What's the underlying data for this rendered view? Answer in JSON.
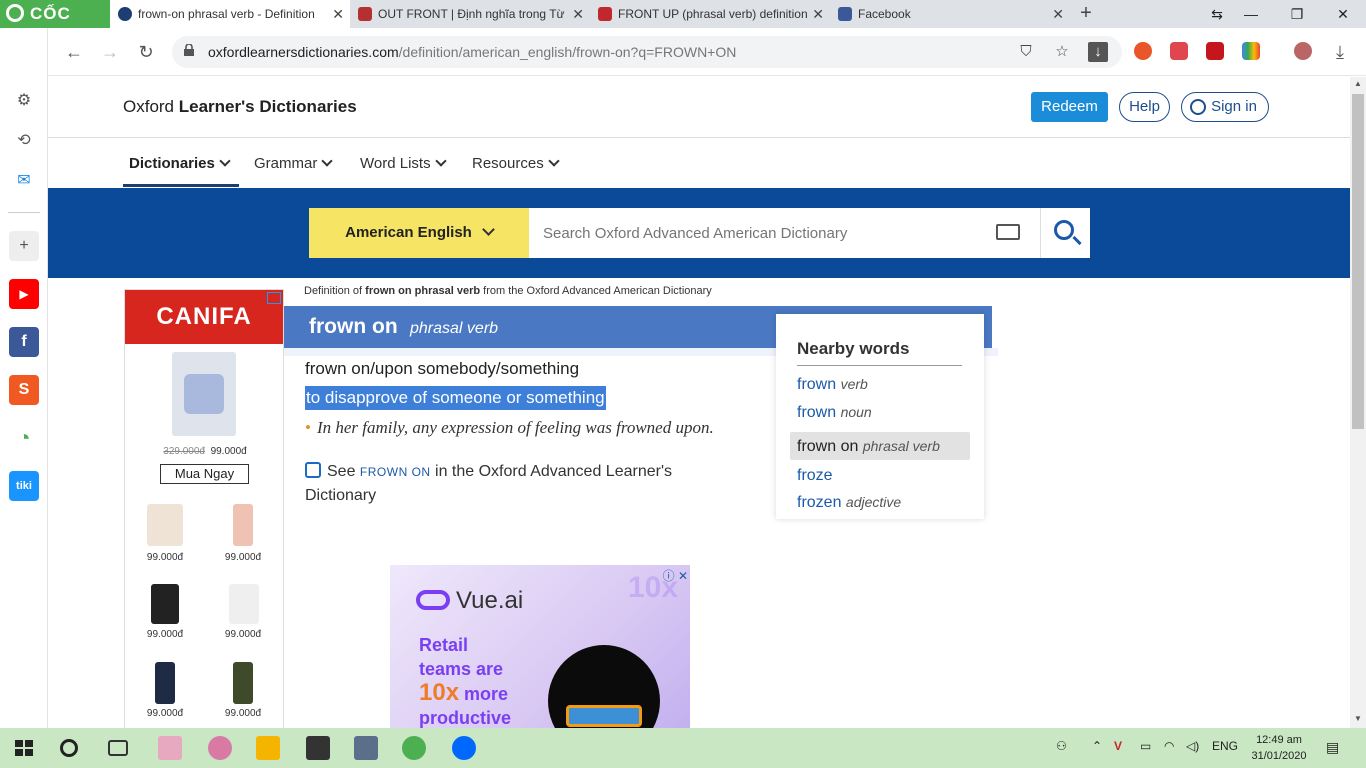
{
  "browser": {
    "logo": "CỐC CỐC",
    "tabs": [
      {
        "title": "frown-on phrasal verb - Definition",
        "active": true
      },
      {
        "title": "OUT FRONT | Định nghĩa trong Từ",
        "active": false
      },
      {
        "title": "FRONT UP (phrasal verb) definition",
        "active": false
      },
      {
        "title": "Facebook",
        "active": false
      }
    ],
    "url_host": "oxfordlearnersdictionaries.com",
    "url_path": "/definition/american_english/frown-on?q=FROWN+ON"
  },
  "site": {
    "brand_light": "Oxford ",
    "brand_bold": "Learner's Dictionaries",
    "redeem_label": "Redeem",
    "help_label": "Help",
    "signin_label": "Sign in",
    "nav": [
      "Dictionaries",
      "Grammar",
      "Word Lists",
      "Resources"
    ],
    "lang_label": "American English",
    "search_placeholder": "Search Oxford Advanced American Dictionary"
  },
  "ad_left": {
    "brand": "CANIFA",
    "old_price": "329.000đ",
    "new_price": "99.000đ",
    "cta": "Mua Ngay",
    "prices": [
      "99.000đ",
      "99.000đ",
      "99.000đ",
      "99.000đ",
      "99.000đ",
      "99.000đ"
    ]
  },
  "entry": {
    "label_prefix": "Definition of ",
    "label_bold": "frown on phrasal verb",
    "label_suffix": " from the Oxford Advanced American Dictionary",
    "headword": "frown on",
    "pos": "phrasal verb",
    "sense": "frown on/upon somebody/something",
    "meaning": "to disapprove of someone or something",
    "example": "In her family, any expression of feeling was frowned upon.",
    "see_prefix": "See ",
    "see_link": "FROWN ON",
    "see_suffix": " in the Oxford Advanced Learner's Dictionary"
  },
  "nearby": {
    "title": "Nearby words",
    "items": [
      {
        "word": "frown",
        "pos": "verb"
      },
      {
        "word": "frown",
        "pos": "noun"
      },
      {
        "word": "frown on",
        "pos": "phrasal verb"
      },
      {
        "word": "froze",
        "pos": ""
      },
      {
        "word": "frozen",
        "pos": "adjective"
      }
    ]
  },
  "ad_vue": {
    "brand": "Vue.ai",
    "line1": "Retail",
    "line2": "teams are",
    "big": "10x",
    "line3": " more",
    "line4": "productive",
    "badge": "10x"
  },
  "taskbar": {
    "lang": "ENG",
    "time": "12:49 am",
    "date": "31/01/2020"
  },
  "colors": {
    "oxford_blue": "#0b4a99",
    "head_bar": "#4a78c2",
    "highlight": "#3d7fd9",
    "lang_yellow": "#f6e565",
    "canifa_red": "#d7261e"
  }
}
